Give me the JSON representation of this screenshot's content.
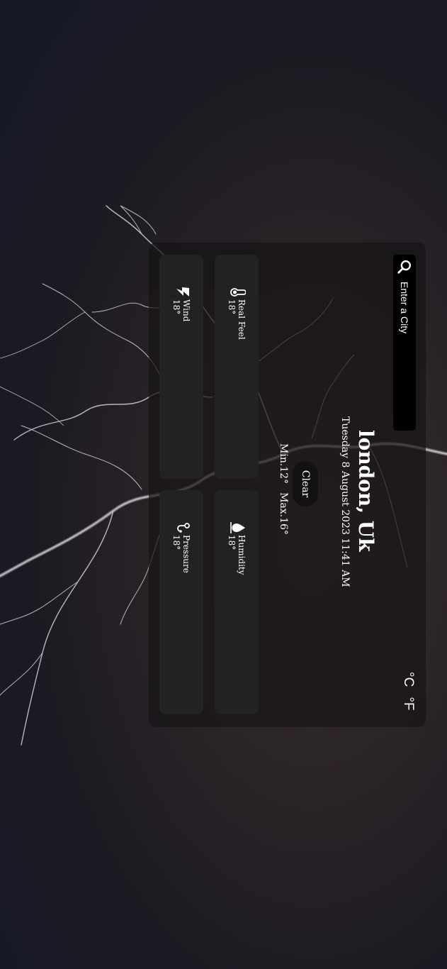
{
  "search": {
    "placeholder": "Enter a City"
  },
  "units": {
    "celsius": "°C",
    "fahrenheit": "°F"
  },
  "weather": {
    "city": "london, Uk",
    "datetime": "Tuesday 8 August 2023 11:41 AM",
    "condition": "Clear",
    "min": "Min.12°",
    "max": "Max.16°"
  },
  "cards": {
    "real_feel": {
      "label": "Real Feel",
      "value": "18°",
      "icon": "thermometer-icon"
    },
    "humidity": {
      "label": "Humidity",
      "value": "18°",
      "icon": "droplet-icon"
    },
    "wind": {
      "label": "Wind",
      "value": "18°",
      "icon": "wind-icon"
    },
    "pressure": {
      "label": "Pressure",
      "value": "18°",
      "icon": "gauge-icon"
    }
  }
}
